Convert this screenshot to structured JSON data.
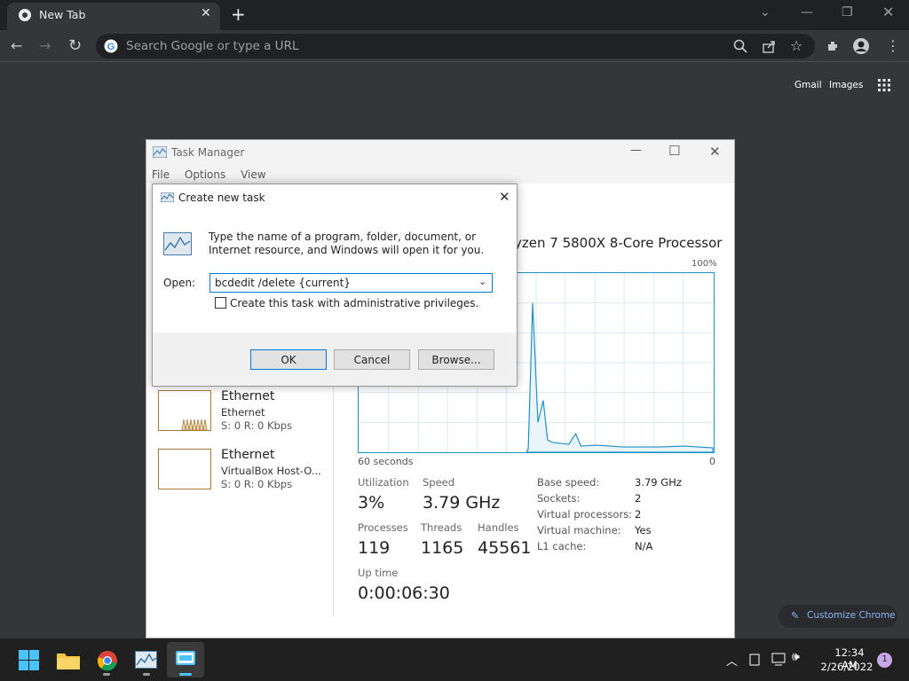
{
  "browser": {
    "tab_title": "New Tab",
    "omnibox_placeholder": "Search Google or type a URL",
    "gmail": "Gmail",
    "images": "Images",
    "customize": "Customize Chrome"
  },
  "task_manager": {
    "title": "Task Manager",
    "menu": [
      "File",
      "Options",
      "View"
    ],
    "cpu_name": "yzen 7 5800X 8-Core Processor",
    "graph_max": "100%",
    "graph_left": "60 seconds",
    "graph_right": "0",
    "sidebar": [
      {
        "title": "Ethernet",
        "sub": "Ethernet",
        "stat": "S: 0 R: 0 Kbps"
      },
      {
        "title": "Ethernet",
        "sub": "VirtualBox Host-O...",
        "stat": "S: 0 R: 0 Kbps"
      }
    ],
    "stats": {
      "utilization_label": "Utilization",
      "utilization": "3%",
      "speed_label": "Speed",
      "speed": "3.79 GHz",
      "processes_label": "Processes",
      "processes": "119",
      "threads_label": "Threads",
      "threads": "1165",
      "handles_label": "Handles",
      "handles": "45561",
      "uptime_label": "Up time",
      "uptime": "0:00:06:30"
    },
    "details": [
      {
        "label": "Base speed:",
        "value": "3.79 GHz"
      },
      {
        "label": "Sockets:",
        "value": "2"
      },
      {
        "label": "Virtual processors:",
        "value": "2"
      },
      {
        "label": "Virtual machine:",
        "value": "Yes"
      },
      {
        "label": "L1 cache:",
        "value": "N/A"
      }
    ]
  },
  "dialog": {
    "title": "Create new task",
    "message": "Type the name of a program, folder, document, or Internet resource, and Windows will open it for you.",
    "open_label": "Open:",
    "open_value": "bcdedit /delete {current}",
    "admin_label": "Create this task with administrative privileges.",
    "ok": "OK",
    "cancel": "Cancel",
    "browse": "Browse..."
  },
  "taskbar": {
    "time": "12:34 AM",
    "date": "2/26/2022",
    "notifications": "1"
  },
  "colors": {
    "accent": "#0078d7",
    "graph": "#1e90c8",
    "chrome_dark": "#202124"
  }
}
